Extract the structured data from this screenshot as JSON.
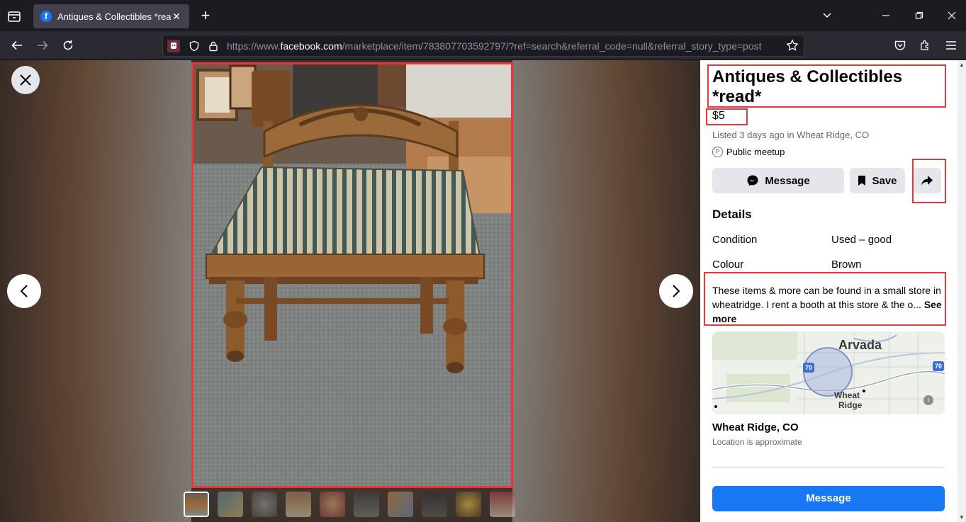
{
  "browser": {
    "tab_title": "Antiques & Collectibles *read* -",
    "url_prefix": "https://www.",
    "url_host": "facebook.com",
    "url_path": "/marketplace/item/783807703592797/?ref=search&referral_code=null&referral_story_type=post"
  },
  "listing": {
    "title": "Antiques & Collectibles *read*",
    "price": "$5",
    "listed": "Listed 3 days ago in Wheat Ridge, CO",
    "meetup": "Public meetup",
    "message_label": "Message",
    "save_label": "Save",
    "details_heading": "Details",
    "details": [
      {
        "label": "Condition",
        "value": "Used – good"
      },
      {
        "label": "Colour",
        "value": "Brown"
      }
    ],
    "description": "These items & more can be found in a small store in wheatridge. I rent a booth at this store & the o...",
    "see_more": "See more",
    "map_labels": {
      "city1": "Arvada",
      "city2a": "Wheat",
      "city2b": "Ridge",
      "highway": "70"
    },
    "location_name": "Wheat Ridge, CO",
    "location_note": "Location is approximate",
    "primary_message_label": "Message"
  },
  "colors": {
    "accent": "#1877f2",
    "highlight": "#e5383b"
  }
}
